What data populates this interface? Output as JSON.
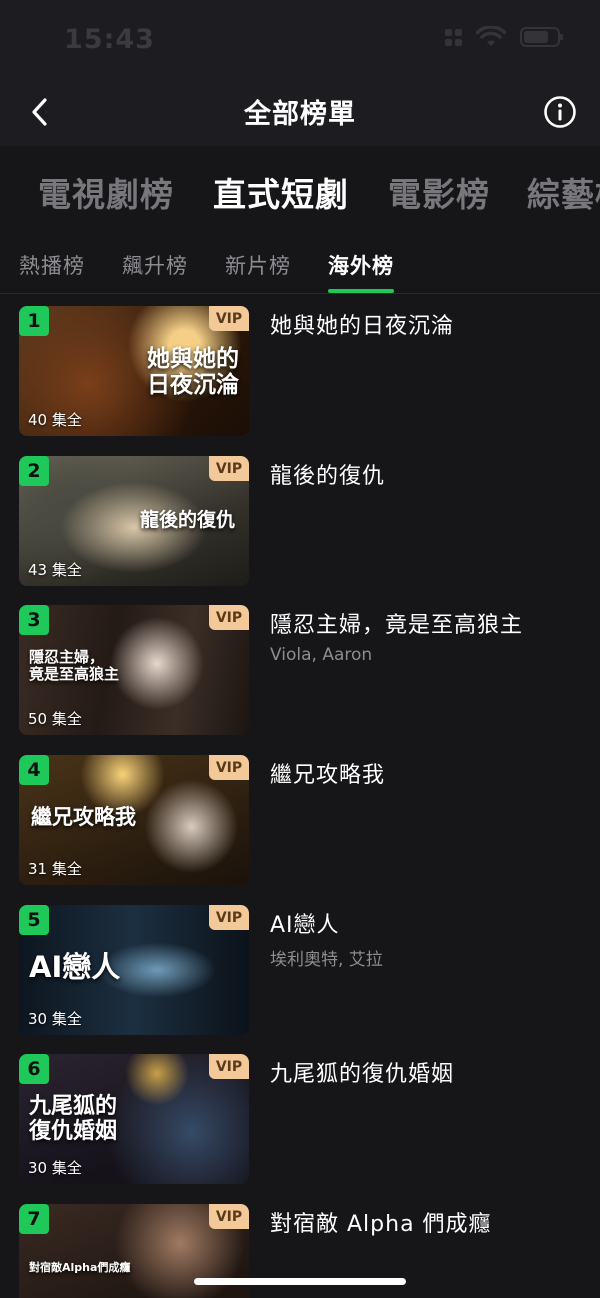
{
  "status_bar": {
    "time": "15:43"
  },
  "nav": {
    "title": "全部榜單",
    "back_icon": "chevron-left-icon",
    "info_icon": "info-circle-icon"
  },
  "primary_tabs": [
    {
      "label": "電視劇榜",
      "active": false
    },
    {
      "label": "直式短劇",
      "active": true
    },
    {
      "label": "電影榜",
      "active": false
    },
    {
      "label": "綜藝榜",
      "active": false
    }
  ],
  "secondary_tabs": [
    {
      "label": "熱播榜",
      "active": false
    },
    {
      "label": "飆升榜",
      "active": false
    },
    {
      "label": "新片榜",
      "active": false
    },
    {
      "label": "海外榜",
      "active": true
    }
  ],
  "accent_color": "#1ec95a",
  "vip_color": "#f3c99a",
  "items": [
    {
      "rank": "1",
      "vip": "VIP",
      "episodes": "40 集全",
      "title": "她與她的日夜沉淪",
      "subtitle": "",
      "poster_text": "她與她的\n日夜沉淪"
    },
    {
      "rank": "2",
      "vip": "VIP",
      "episodes": "43 集全",
      "title": "龍後的復仇",
      "subtitle": "",
      "poster_text": "龍後的復仇"
    },
    {
      "rank": "3",
      "vip": "VIP",
      "episodes": "50 集全",
      "title": "隱忍主婦，竟是至高狼主",
      "subtitle": "Viola, Aaron",
      "poster_text": "隱忍主婦，\n竟是至高狼主"
    },
    {
      "rank": "4",
      "vip": "VIP",
      "episodes": "31 集全",
      "title": "繼兄攻略我",
      "subtitle": "",
      "poster_text": "繼兄攻略我"
    },
    {
      "rank": "5",
      "vip": "VIP",
      "episodes": "30 集全",
      "title": "AI戀人",
      "subtitle": "埃利奧特, 艾拉",
      "poster_text": "AI戀人"
    },
    {
      "rank": "6",
      "vip": "VIP",
      "episodes": "30 集全",
      "title": "九尾狐的復仇婚姻",
      "subtitle": "",
      "poster_text": "九尾狐的\n復仇婚姻"
    },
    {
      "rank": "7",
      "vip": "VIP",
      "episodes": "",
      "title": "對宿敵 Alpha 們成癮",
      "subtitle": "",
      "poster_text": "對宿敵Alpha們成癮"
    }
  ]
}
